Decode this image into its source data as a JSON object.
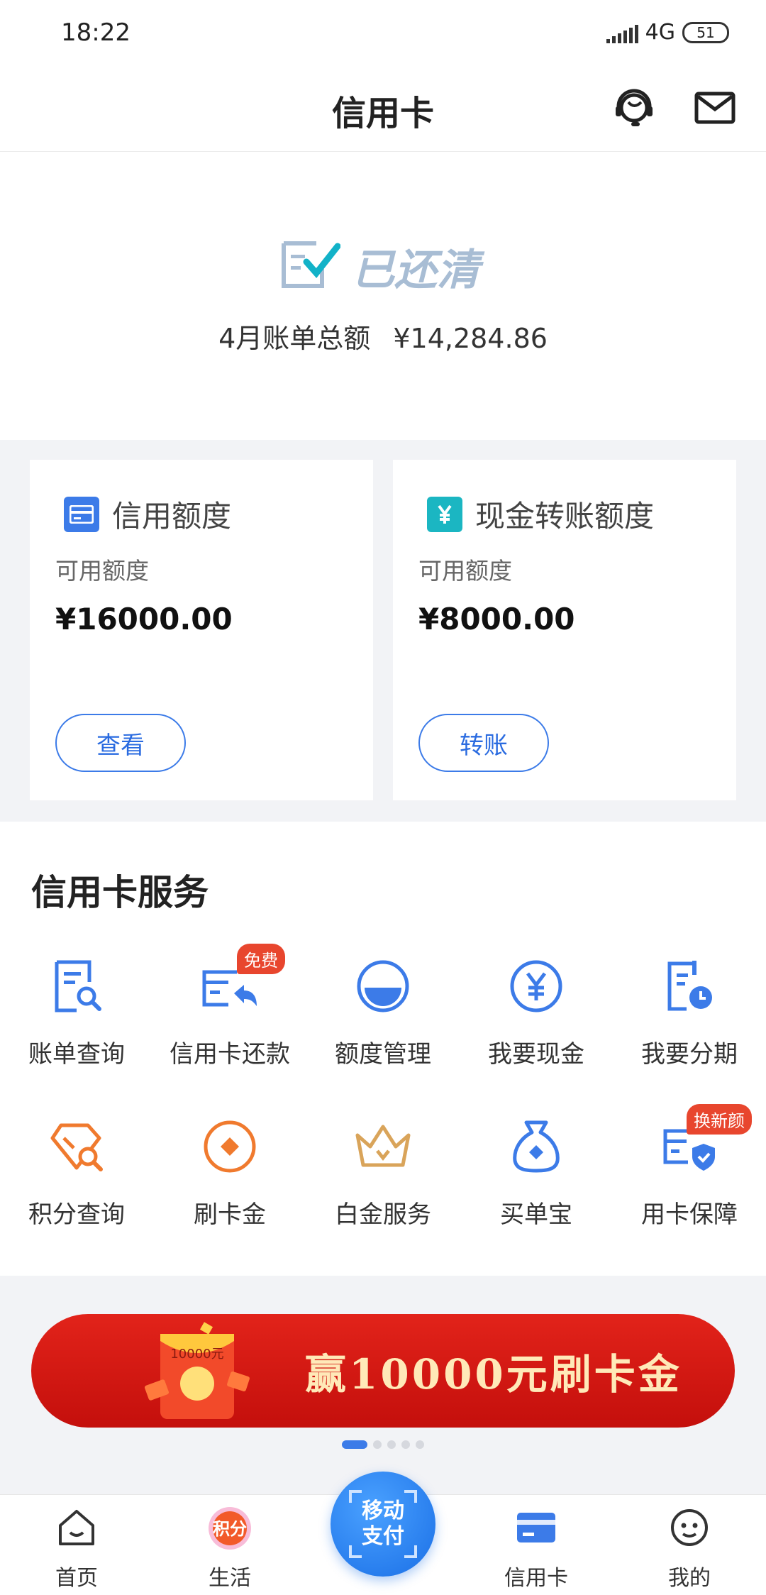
{
  "status_bar": {
    "time": "18:22",
    "network": "4G",
    "battery": "51"
  },
  "header": {
    "title": "信用卡",
    "support_icon": "customer-service-icon",
    "message_icon": "mail-icon"
  },
  "bill": {
    "status": "已还清",
    "label": "4月账单总额",
    "amount": "¥14,284.86"
  },
  "cards": [
    {
      "title": "信用额度",
      "icon": "credit-card-icon",
      "sub": "可用额度",
      "amount": "¥16000.00",
      "button": "查看",
      "accent": "#3c7be8"
    },
    {
      "title": "现金转账额度",
      "icon": "yen-icon",
      "sub": "可用额度",
      "amount": "¥8000.00",
      "button": "转账",
      "accent": "#1bb6c2"
    }
  ],
  "services": {
    "title": "信用卡服务",
    "items": [
      {
        "label": "账单查询",
        "icon": "bill-search-icon"
      },
      {
        "label": "信用卡还款",
        "icon": "repay-icon",
        "badge": "免费"
      },
      {
        "label": "额度管理",
        "icon": "limit-gauge-icon"
      },
      {
        "label": "我要现金",
        "icon": "cash-yen-icon"
      },
      {
        "label": "我要分期",
        "icon": "installment-icon"
      },
      {
        "label": "积分查询",
        "icon": "points-search-icon"
      },
      {
        "label": "刷卡金",
        "icon": "card-reward-icon"
      },
      {
        "label": "白金服务",
        "icon": "crown-icon"
      },
      {
        "label": "买单宝",
        "icon": "money-bag-icon"
      },
      {
        "label": "用卡保障",
        "icon": "card-shield-icon",
        "badge": "换新颜"
      }
    ]
  },
  "banner": {
    "text": "赢10000元刷卡金",
    "envelope_text": "10000元",
    "pages": 5,
    "active_page": 1
  },
  "tabbar": {
    "items": [
      {
        "label": "首页",
        "icon": "home-icon"
      },
      {
        "label": "生活",
        "icon": "points-life-icon",
        "icon_text": "积分"
      },
      {
        "label": "信用卡",
        "icon": "credit-card-tab-icon",
        "active": true
      },
      {
        "label": "我的",
        "icon": "profile-icon"
      }
    ],
    "center": {
      "label": "移动支付",
      "icon": "scan-pay-icon"
    }
  },
  "colors": {
    "primary": "#3c7be8",
    "orange": "#f07a2e",
    "gold": "#d9a45a",
    "banner_red": "#d4170f"
  }
}
